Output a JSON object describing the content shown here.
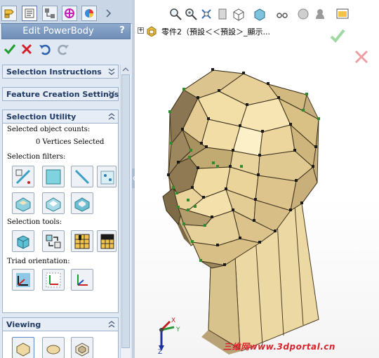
{
  "manager_tabs": [
    {
      "name": "feature-manager-tab",
      "icon": "feature-tree-icon"
    },
    {
      "name": "property-manager-tab",
      "icon": "property-manager-icon"
    },
    {
      "name": "configuration-manager-tab",
      "icon": "configuration-icon"
    },
    {
      "name": "dimxpert-manager-tab",
      "icon": "dimxpert-icon"
    },
    {
      "name": "display-manager-tab",
      "icon": "appearance-icon"
    }
  ],
  "property_manager": {
    "title": "Edit PowerBody",
    "help": "?",
    "actions": [
      "ok-check-icon",
      "cancel-x-icon",
      "undo-icon",
      "redo-icon"
    ]
  },
  "sections": {
    "selection_instructions": "Selection Instructions",
    "feature_creation": "Feature Creation Settings",
    "selection_utility": {
      "title": "Selection Utility",
      "counts_label": "Selected object counts:",
      "counts_value": "0 Vertices Selected",
      "filters_label": "Selection filters:",
      "tools_label": "Selection tools:",
      "triad_label": "Triad orientation:"
    },
    "viewing": "Viewing"
  },
  "viewport": {
    "tree_label": "零件2（預設＜＜預設＞_顯示...",
    "toolbar_icons": [
      "zoom-to-fit-icon",
      "zoom-area-icon",
      "previous-view-icon",
      "section-view-icon",
      "view-orientation-icon",
      "display-style-icon",
      "hide-show-icon",
      "edit-appearance-icon",
      "scene-icon",
      "view-settings-icon"
    ],
    "watermark": "三维网www.3dportal.cn",
    "triad_axes": {
      "x": "X",
      "y": "Y",
      "z": "Z"
    }
  },
  "colors": {
    "panel_bg": "#dfe8f3",
    "header_bg": "#7d99c1",
    "model_face": "#efdca7",
    "model_shadow": "#8c7851",
    "vertex_green": "#2e8b2e",
    "accept_green": "#1f9e2f",
    "cancel_red": "#d0202a"
  }
}
